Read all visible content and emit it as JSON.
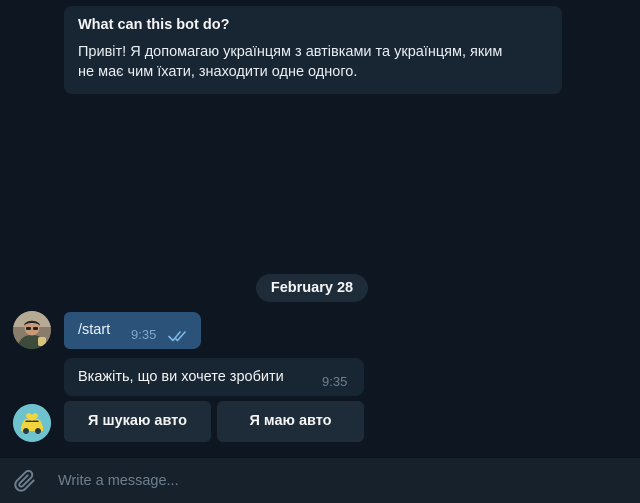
{
  "bot_info": {
    "title": "What can this bot do?",
    "line1": "Привіт! Я допомагаю українцям з автівками та українцям, яким",
    "line2": "не має чим їхати, знаходити одне одного."
  },
  "date_badge": "February 28",
  "messages": [
    {
      "sender": "user",
      "text": "/start",
      "time": "9:35",
      "status": "read"
    },
    {
      "sender": "bot",
      "text": "Вкажіть, що ви хочете зробити",
      "time": "9:35"
    }
  ],
  "keyboard": {
    "buttons": [
      "Я шукаю авто",
      "Я маю авто"
    ]
  },
  "composer": {
    "placeholder": "Write a message..."
  },
  "icons": {
    "attach": "paperclip-icon",
    "read_status": "double-check-icon"
  },
  "colors": {
    "background": "#0e1621",
    "bubble_incoming": "#182533",
    "bubble_outgoing": "#2b5278",
    "composer": "#17212b",
    "muted_text": "#6d7f8f"
  }
}
